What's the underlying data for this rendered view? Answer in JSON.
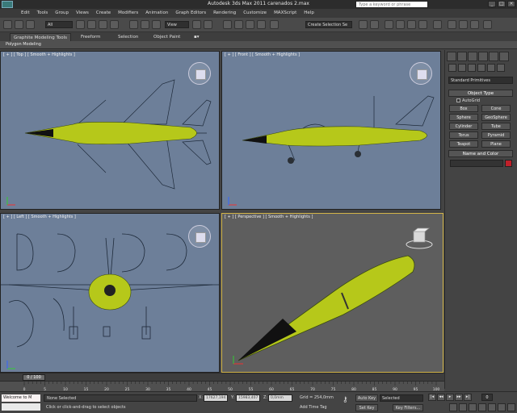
{
  "app": {
    "title": "Autodesk 3ds Max  2011      carenados 2.max",
    "search_placeholder": "Type a keyword or phrase"
  },
  "menu": [
    "Edit",
    "Tools",
    "Group",
    "Views",
    "Create",
    "Modifiers",
    "Animation",
    "Graph Editors",
    "Rendering",
    "Customize",
    "MAXScript",
    "Help"
  ],
  "toolbar": {
    "filter_value": "All",
    "view_value": "View",
    "selection_set": "Create Selection Se"
  },
  "ribbon": {
    "tabs": [
      "Graphite Modeling Tools",
      "Freeform",
      "Selection",
      "Object Paint"
    ],
    "panel_label": "Polygon Modeling"
  },
  "viewports": {
    "top": "[ + ] [ Top ] [ Smooth + Highlights ]",
    "front": "[ + ] [ Front ] [ Smooth + Highlights ]",
    "left": "[ + ] [ Left ] [ Smooth + Highlights ]",
    "perspective": "[ + ] [ Perspective ] [ Smooth + Highlights ]"
  },
  "command_panel": {
    "category": "Standard Primitives",
    "object_type_title": "Object Type",
    "autogrid_label": "AutoGrid",
    "buttons": [
      "Box",
      "Cone",
      "Sphere",
      "GeoSphere",
      "Cylinder",
      "Tube",
      "Torus",
      "Pyramid",
      "Teapot",
      "Plane"
    ],
    "name_color_title": "Name and Color",
    "object_color": "#c0202a"
  },
  "timeline": {
    "slider_label": "0 / 100",
    "ticks": [
      "0",
      "5",
      "10",
      "15",
      "20",
      "25",
      "30",
      "35",
      "40",
      "45",
      "50",
      "55",
      "60",
      "65",
      "70",
      "75",
      "80",
      "85",
      "90",
      "95",
      "100"
    ]
  },
  "status": {
    "maxscript_text": "Welcome to M",
    "selection_text": "None Selected",
    "prompt_text": "Click or click-and-drag to select objects",
    "x_label": "X:",
    "x_value": "17627,194",
    "y_label": "Y:",
    "y_value": "15983,407",
    "z_label": "Z:",
    "z_value": "0,0mm",
    "grid_text": "Grid = 254,0mm",
    "add_time_tag": "Add Time Tag",
    "auto_key": "Auto Key",
    "set_key": "Set Key",
    "key_mode": "Selected",
    "key_filters": "Key Filters...",
    "current_frame": "0"
  },
  "colors": {
    "viewport_blue": "#6d7f99",
    "jet_yellow_green": "#b6c81a",
    "active_viewport_border": "#d2b448"
  }
}
